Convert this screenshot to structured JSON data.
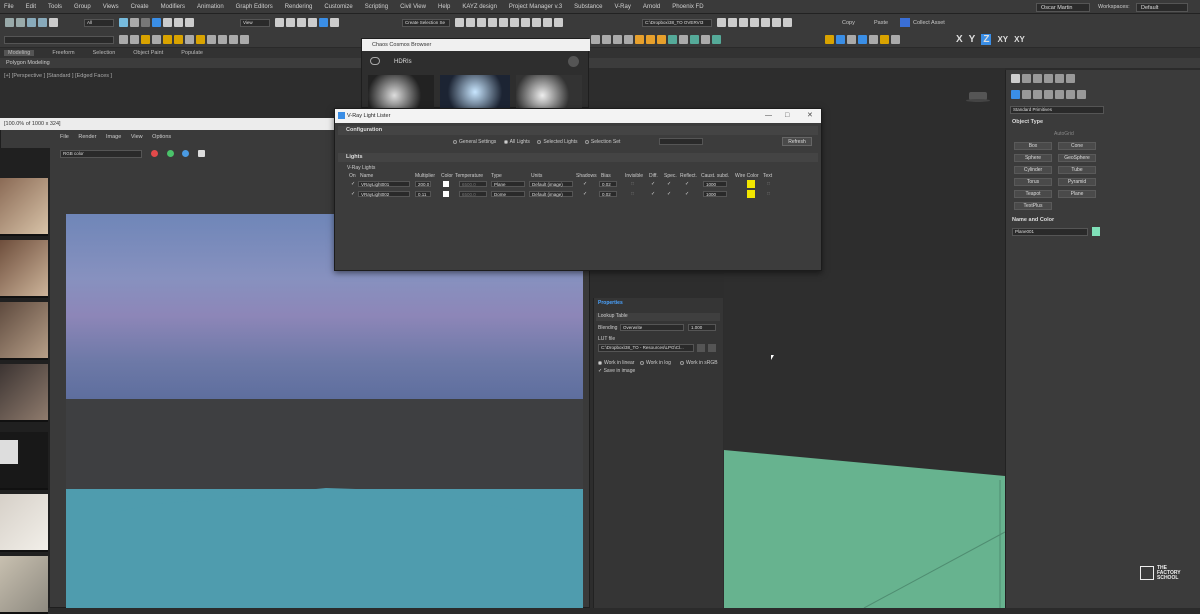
{
  "menu": [
    "File",
    "Edit",
    "Tools",
    "Group",
    "Views",
    "Create",
    "Modifiers",
    "Animation",
    "Graph Editors",
    "Rendering",
    "Customize",
    "Scripting",
    "Civil View",
    "Help",
    "KAYZ design",
    "Project Manager v.3",
    "Substance",
    "V-Ray",
    "Arnold",
    "Phoenix FD"
  ],
  "user": "Oscar Martin",
  "workspaces_label": "Workspaces:",
  "workspace": "Default",
  "ribbon_tabs": [
    "Modeling",
    "Freeform",
    "Selection",
    "Object Paint",
    "Populate"
  ],
  "ribbon_sub": "Polygon Modeling",
  "toolbar": {
    "all_filter": "All",
    "view": "View",
    "selection_set": "Create Selection Se",
    "path": "C:\\Dropbox\\38_TO OVERVI3",
    "copy": "Copy",
    "paste": "Paste",
    "collect_asset": "Collect Asset"
  },
  "axis_buttons": [
    "X",
    "Y",
    "Z",
    "XY",
    "XY"
  ],
  "viewport_label": "[+] [Perspective ] [Standard ] [Edged Faces ]",
  "frame_buffer": {
    "title": "[100.0% of 1000 x 324]",
    "menu": [
      "File",
      "Render",
      "Image",
      "View",
      "Options"
    ],
    "channel": "RGB color"
  },
  "chaos_browser": {
    "title": "Chaos Cosmos Browser",
    "tab": "HDRIs"
  },
  "light_lister": {
    "title": "V-Ray Light Lister",
    "configuration": "Configuration",
    "radios": [
      "General Settings",
      "All Lights",
      "Selected Lights",
      "Selection Set"
    ],
    "refresh": "Refresh",
    "lights_section": "Lights",
    "group": "V-Ray Lights",
    "columns": [
      "On",
      "Name",
      "Multiplier",
      "Color",
      "Temperature",
      "Type",
      "Units",
      "Shadows",
      "Bias",
      "Invisible",
      "Diff.",
      "Spec.",
      "Reflect.",
      "Caust. subd.",
      "Wire Color",
      "Text"
    ],
    "rows": [
      {
        "name": "VRayLight001",
        "multiplier": "200.0",
        "temperature": "6500.0",
        "type": "Plane",
        "units": "Default (image)",
        "bias": "0.02",
        "subd": "1000"
      },
      {
        "name": "VRayLight002",
        "multiplier": "0.11",
        "temperature": "6500.0",
        "type": "Dome",
        "units": "Default (image)",
        "bias": "0.02",
        "subd": "1000"
      }
    ]
  },
  "properties": {
    "title": "Properties",
    "lookup": "Lookup Table",
    "blending_label": "Blending",
    "blending": "Overwrite",
    "blend_value": "1.000",
    "lut_label": "LUT file",
    "lut_path": "C:\\Dropbox\\38_TO - Resources\\LPG\\Cl...",
    "options": [
      "Work in linear",
      "Work in log",
      "Work in sRGB",
      "Save in image"
    ]
  },
  "command_panel": {
    "category": "Standard Primitives",
    "object_type": "Object Type",
    "autogrid": "AutoGrid",
    "objects": [
      "Box",
      "Cone",
      "Sphere",
      "GeoSphere",
      "Cylinder",
      "Tube",
      "Torus",
      "Pyramid",
      "Teapot",
      "Plane",
      "TextPlus"
    ],
    "name_and_color": "Name and Color",
    "object_name": "Plane001",
    "object_color": "#7fe0b8"
  },
  "logo": [
    "THE",
    "FACTORY",
    "SCHOOL"
  ],
  "colors": {
    "swatch_yellow": "#f2e600",
    "plane": "#67b38f",
    "water": "#4f9cae"
  }
}
